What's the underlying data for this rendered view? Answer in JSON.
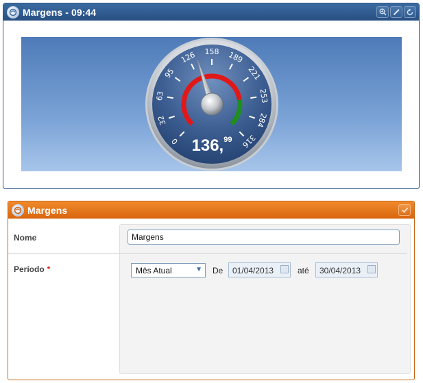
{
  "gauge_window": {
    "title": "Margens - 09:44",
    "buttons": [
      "zoom-icon",
      "edit-icon",
      "refresh-icon"
    ],
    "colors": {
      "title_bar": "#2e5688",
      "background": "#5e8cc6"
    },
    "gauge": {
      "ticks": [
        "0",
        "32",
        "63",
        "95",
        "126",
        "158",
        "189",
        "221",
        "253",
        "284",
        "316"
      ],
      "min": 0,
      "max": 316,
      "value": 136.99,
      "value_main": "136,",
      "value_decimals": "99",
      "bands": [
        {
          "from": 0,
          "to": 253,
          "color": "#e11818"
        },
        {
          "from": 253,
          "to": 316,
          "color": "#1f8e1f"
        }
      ]
    }
  },
  "form_window": {
    "title": "Margens",
    "colors": {
      "title_bar": "#e0711a"
    },
    "fields": {
      "nome": {
        "label": "Nome",
        "value": "Margens"
      },
      "periodo": {
        "label": "Período",
        "required_mark": "*",
        "select_value": "Mês Atual",
        "de_label": "De",
        "date_from": "01/04/2013",
        "ate_label": "até",
        "date_to": "30/04/2013"
      }
    }
  }
}
